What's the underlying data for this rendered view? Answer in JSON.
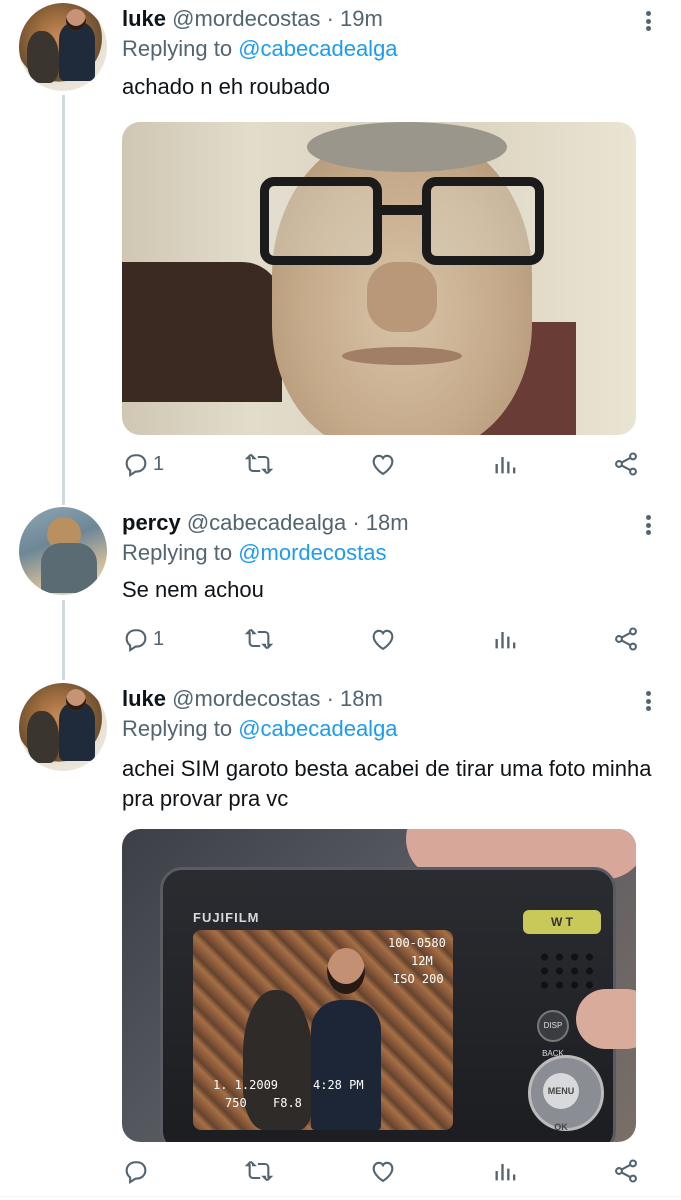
{
  "tweets": [
    {
      "name": "luke",
      "handle": "@mordecostas",
      "sep": "·",
      "time": "19m",
      "replying_prefix": "Replying to",
      "replying_to": "@cabecadealga",
      "text": "achado n eh roubado",
      "reply_count": "1",
      "avatar_icon": "avatar-luke",
      "media": "photo-old-man-with-glasses"
    },
    {
      "name": "percy",
      "handle": "@cabecadealga",
      "sep": "·",
      "time": "18m",
      "replying_prefix": "Replying to",
      "replying_to": "@mordecostas",
      "text": "Se nem achou",
      "reply_count": "1",
      "avatar_icon": "avatar-percy"
    },
    {
      "name": "luke",
      "handle": "@mordecostas",
      "sep": "·",
      "time": "18m",
      "replying_prefix": "Replying to",
      "replying_to": "@cabecadealga",
      "text": "achei SIM garoto besta acabei de tirar uma foto minha pra provar pra vc",
      "reply_count": "",
      "avatar_icon": "avatar-luke",
      "media": "photo-camera-screen"
    }
  ],
  "camera_photo": {
    "brand": "FUJIFILM",
    "frame": "100-0580",
    "megapixels": "12M",
    "iso": "ISO 200",
    "date": "1. 1.2009",
    "time": "4:28 PM",
    "shutter": "750",
    "aperture": "F8.8",
    "zoom": "W  T",
    "disp": "DISP BACK",
    "menu": "MENU OK"
  },
  "icons": [
    "reply-icon",
    "retweet-icon",
    "like-icon",
    "views-icon",
    "share-icon",
    "more-icon"
  ],
  "colors": {
    "link": "#1d9bf0",
    "secondary_text": "#536471",
    "thread_line": "#cfd9de"
  }
}
